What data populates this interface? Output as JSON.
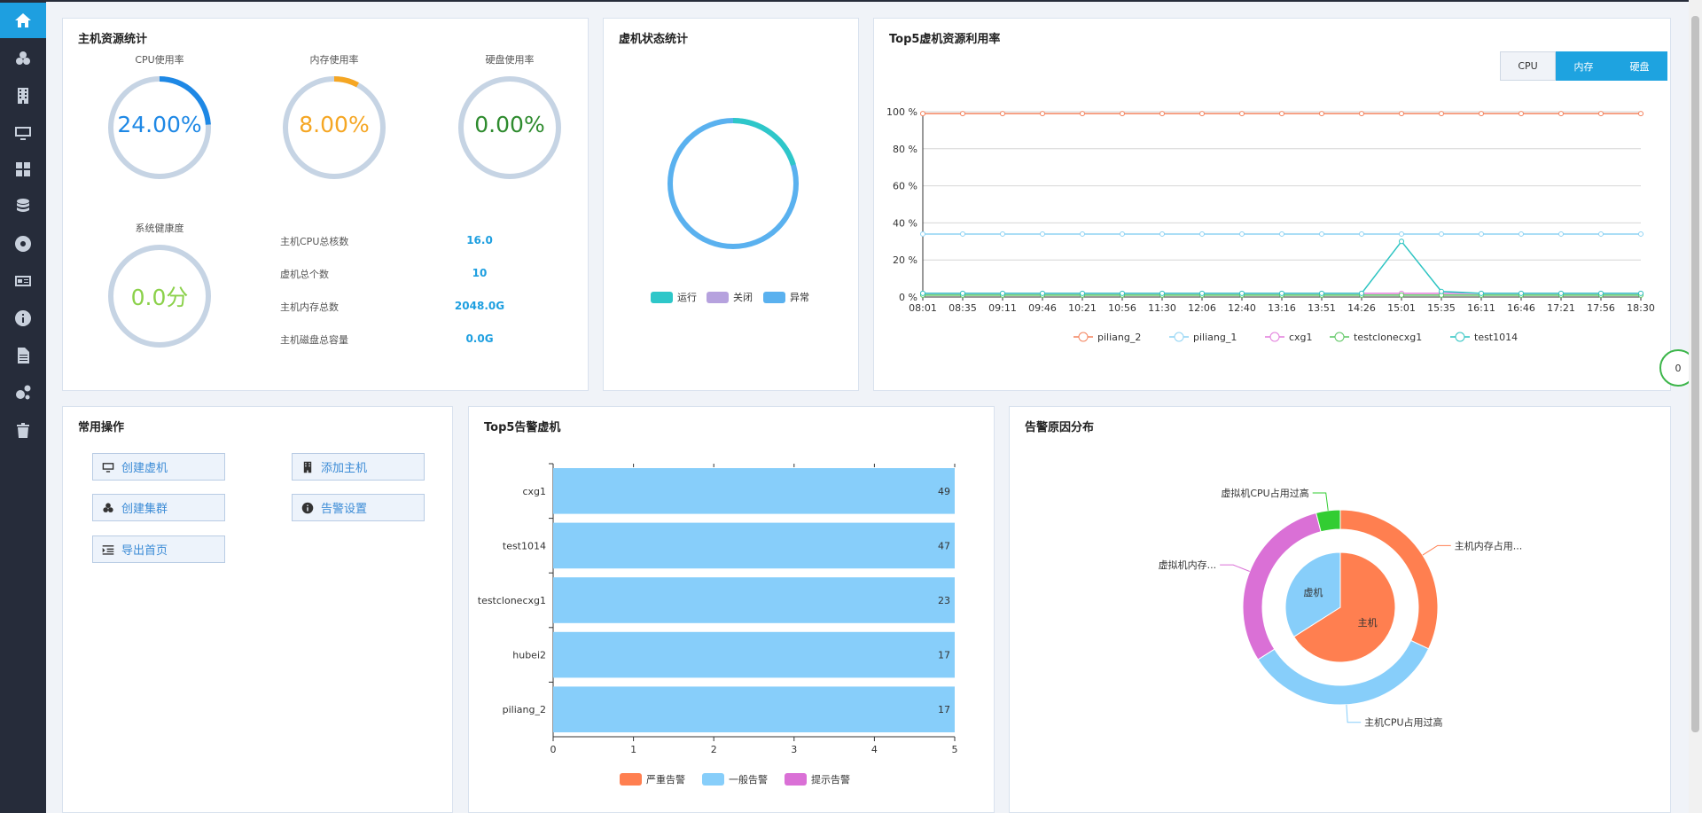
{
  "sidebar": {
    "items": [
      {
        "icon": "home-icon"
      },
      {
        "icon": "cluster-icon"
      },
      {
        "icon": "building-icon"
      },
      {
        "icon": "monitor-icon"
      },
      {
        "icon": "dashboard-icon"
      },
      {
        "icon": "database-icon"
      },
      {
        "icon": "disc-icon"
      },
      {
        "icon": "id-card-icon"
      },
      {
        "icon": "info-icon"
      },
      {
        "icon": "document-icon"
      },
      {
        "icon": "gears-icon"
      },
      {
        "icon": "trash-icon"
      }
    ]
  },
  "host_stats": {
    "title": "主机资源统计",
    "cpu": {
      "label": "CPU使用率",
      "value_text": "24.00%",
      "percent": 24,
      "color": "#1e88e5"
    },
    "mem": {
      "label": "内存使用率",
      "value_text": "8.00%",
      "percent": 8,
      "color": "#f5a623"
    },
    "disk": {
      "label": "硬盘使用率",
      "value_text": "0.00%",
      "percent": 0,
      "color": "#2e8b2e"
    },
    "health": {
      "label": "系统健康度",
      "value_text": "0.0分",
      "percent": 0,
      "color": "#8bd14a"
    },
    "rows": [
      {
        "label": "主机CPU总核数",
        "value": "16.0"
      },
      {
        "label": "虚机总个数",
        "value": "10"
      },
      {
        "label": "主机内存总数",
        "value": "2048.0G"
      },
      {
        "label": "主机磁盘总容量",
        "value": "0.0G"
      }
    ]
  },
  "vm_status": {
    "title": "虚机状态统计",
    "legend": [
      {
        "label": "运行",
        "color": "#2ec7c9"
      },
      {
        "label": "关闭",
        "color": "#b6a2de"
      },
      {
        "label": "异常",
        "color": "#5ab1ef"
      }
    ]
  },
  "top5_util": {
    "title": "Top5虚机资源利用率",
    "tabs": [
      {
        "label": "CPU",
        "active": false
      },
      {
        "label": "内存",
        "active": true
      },
      {
        "label": "硬盘",
        "active": true
      }
    ]
  },
  "ops": {
    "title": "常用操作",
    "buttons": [
      {
        "label": "创建虚机",
        "icon": "monitor-icon"
      },
      {
        "label": "添加主机",
        "icon": "building-icon"
      },
      {
        "label": "创建集群",
        "icon": "cluster-icon"
      },
      {
        "label": "告警设置",
        "icon": "info-icon"
      },
      {
        "label": "导出首页",
        "icon": "indent-icon"
      }
    ]
  },
  "top5_alarm": {
    "title": "Top5告警虚机"
  },
  "alarm_reason": {
    "title": "告警原因分布"
  },
  "float_badge": {
    "value": "0"
  },
  "chart_data": [
    {
      "type": "line",
      "title": "Top5虚机资源利用率",
      "x": [
        "08:01",
        "08:35",
        "09:11",
        "09:46",
        "10:21",
        "10:56",
        "11:30",
        "12:06",
        "12:40",
        "13:16",
        "13:51",
        "14:26",
        "15:01",
        "15:35",
        "16:11",
        "16:46",
        "17:21",
        "17:56",
        "18:30"
      ],
      "y_ticks": [
        "0 %",
        "20 %",
        "40 %",
        "60 %",
        "80 %",
        "100 %"
      ],
      "ylim": [
        0,
        100
      ],
      "legend_position": "bottom",
      "series": [
        {
          "name": "piliang_2",
          "color": "#f4845f",
          "values": [
            99,
            99,
            99,
            99,
            99,
            99,
            99,
            99,
            99,
            99,
            99,
            99,
            99,
            99,
            99,
            99,
            99,
            99,
            99
          ]
        },
        {
          "name": "piliang_1",
          "color": "#8fd3f4",
          "values": [
            34,
            34,
            34,
            34,
            34,
            34,
            34,
            34,
            34,
            34,
            34,
            34,
            34,
            34,
            34,
            34,
            34,
            34,
            34
          ]
        },
        {
          "name": "cxg1",
          "color": "#e27ddc",
          "values": [
            2,
            2,
            2,
            2,
            2,
            2,
            2,
            2,
            2,
            2,
            2,
            2,
            2,
            2,
            2,
            2,
            2,
            2,
            2
          ]
        },
        {
          "name": "testclonecxg1",
          "color": "#5bc560",
          "values": [
            1,
            1,
            1,
            1,
            1,
            1,
            1,
            1,
            1,
            1,
            1,
            1,
            1,
            1,
            1,
            1,
            1,
            1,
            1
          ]
        },
        {
          "name": "test1014",
          "color": "#2ec4c2",
          "values": [
            2,
            2,
            2,
            2,
            2,
            2,
            2,
            2,
            2,
            2,
            2,
            2,
            30,
            3,
            2,
            2,
            2,
            2,
            2
          ]
        }
      ]
    },
    {
      "type": "bar",
      "orientation": "horizontal",
      "title": "Top5告警虚机",
      "categories": [
        "cxg1",
        "test1014",
        "testclonecxg1",
        "hubei2",
        "piliang_2"
      ],
      "xlim": [
        0,
        5
      ],
      "x_ticks": [
        "0",
        "1",
        "2",
        "3",
        "4",
        "5"
      ],
      "legend_position": "bottom",
      "legend": [
        {
          "label": "严重告警",
          "color": "#ff7f50"
        },
        {
          "label": "一般告警",
          "color": "#87cefa"
        },
        {
          "label": "提示告警",
          "color": "#da70d6"
        }
      ],
      "series": [
        {
          "name": "一般告警",
          "color": "#87cefa",
          "values": [
            49,
            47,
            23,
            17,
            17
          ]
        }
      ]
    },
    {
      "type": "pie",
      "title": "告警原因分布",
      "inner": [
        {
          "label": "主机",
          "value": 66,
          "color": "#ff7f50"
        },
        {
          "label": "虚机",
          "value": 34,
          "color": "#87cefa"
        }
      ],
      "outer": [
        {
          "label": "主机内存占用...",
          "value": 32,
          "color": "#ff7f50"
        },
        {
          "label": "主机CPU占用过高",
          "value": 34,
          "color": "#87cefa"
        },
        {
          "label": "虚拟机内存...",
          "value": 30,
          "color": "#da70d6"
        },
        {
          "label": "虚拟机CPU占用过高",
          "value": 4,
          "color": "#32cd32"
        }
      ]
    }
  ]
}
